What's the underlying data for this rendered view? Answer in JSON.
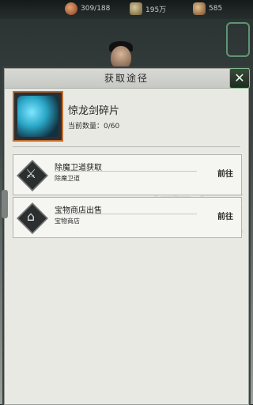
{
  "topbar": {
    "res1": "309/188",
    "res2": "195万",
    "res3": "585"
  },
  "dialog": {
    "title": "获取途径",
    "close_glyph": "✕",
    "item": {
      "name": "惊龙剑碎片",
      "count": "当前数量：0/60"
    },
    "sources": [
      {
        "title": "除魔卫道获取",
        "sub": "除魔卫道",
        "button": "前往",
        "icon": "⚔"
      },
      {
        "title": "宝物商店出售",
        "sub": "宝物商店",
        "button": "前往",
        "icon": "⌂"
      }
    ],
    "bg_text": "侠魔"
  }
}
